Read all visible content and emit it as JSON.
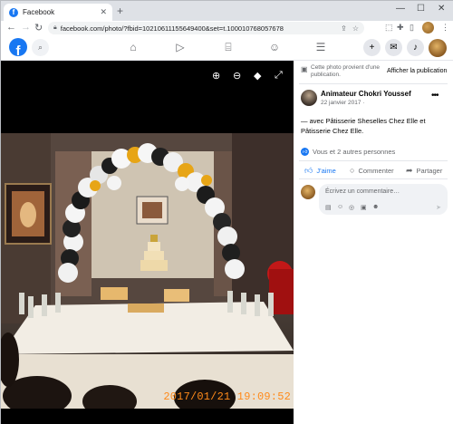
{
  "browser": {
    "tab_title": "Facebook",
    "tab_close": "✕",
    "new_tab": "+",
    "url": "facebook.com/photo/?fbid=10210611155649400&set=t.100010768057678",
    "win_min": "—",
    "win_max": "☐",
    "win_close": "✕"
  },
  "fb_header": {
    "logo": "f",
    "search_icon": "search-icon",
    "nav": [
      "home-icon",
      "watch-icon",
      "marketplace-icon",
      "groups-icon",
      "menu-icon"
    ],
    "actions": [
      "create-icon",
      "messenger-icon",
      "notifications-icon"
    ]
  },
  "viewer": {
    "timestamp": "2017/01/21 19:09:52",
    "toolbar_icons": [
      "zoom-in-icon",
      "zoom-out-icon",
      "tag-icon",
      "fullscreen-icon"
    ]
  },
  "panel": {
    "notice_text": "Cette photo provient d'une publication.",
    "notice_button": "Afficher la publication",
    "author": "Animateur Chokri Youssef",
    "date": "22 janvier 2017 ·",
    "caption": "— avec Pâtisserie Sheselles Chez Elle et Pâtisserie Chez Elle.",
    "reactions": "Vous et 2 autres personnes",
    "like_label": "J'aime",
    "comment_label": "Commenter",
    "share_label": "Partager",
    "comment_placeholder": "Écrivez un commentaire…"
  },
  "colors": {
    "fb_blue": "#1877f2",
    "timestamp_orange": "#ff8a1a"
  }
}
